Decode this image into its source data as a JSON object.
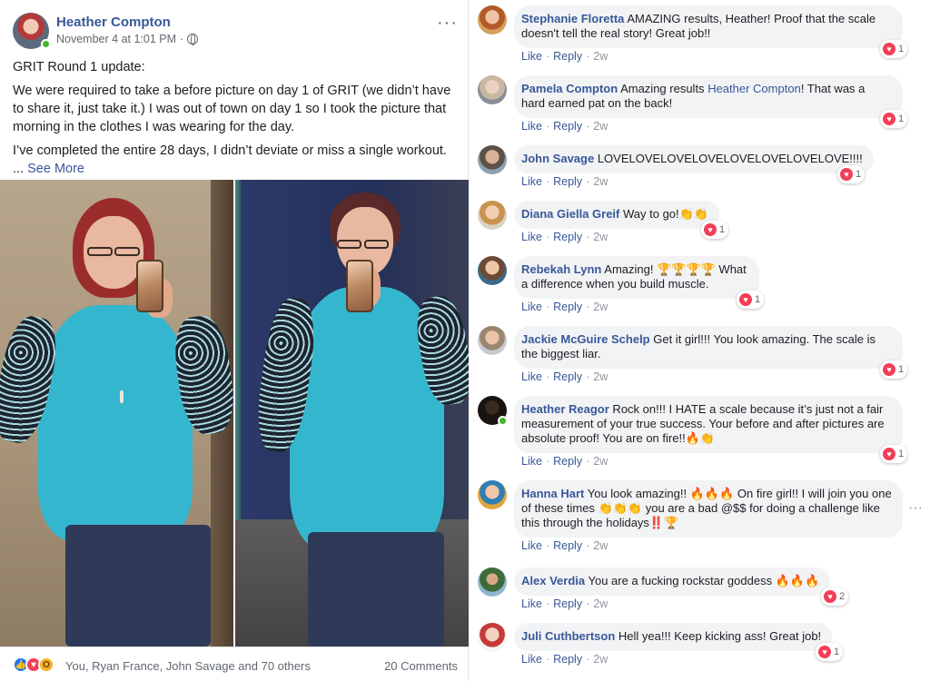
{
  "post": {
    "author": "Heather Compton",
    "timestamp": "November 4 at 1:01 PM",
    "separator": "·",
    "more_glyph": "···",
    "paragraphs": [
      "GRIT Round 1 update:",
      "We were required to take a before picture on day 1 of GRIT (we didn’t have to share it, just take it.) I was out of town on day 1 so I took the picture that morning in the clothes I was wearing for the day.",
      "I’ve completed the entire 28 days, I didn’t deviate or miss a single workout."
    ],
    "ellipsis": "...",
    "see_more": "See More",
    "reactions": {
      "icons": [
        "like-icon",
        "love-icon",
        "wow-icon"
      ],
      "summary": "You, Ryan France, John Savage and 70 others",
      "comments_count": "20 Comments"
    }
  },
  "colors": {
    "link": "#385898",
    "like": "#1877f2",
    "love": "#f33e58",
    "wow": "#f7b125",
    "bubble": "#f2f3f5",
    "online": "#42b72a"
  },
  "comments": [
    {
      "name": "Stephanie Floretta",
      "text": " AMAZING results, Heather! Proof that the scale doesn't tell the real story! Great job!!",
      "reacts": "1",
      "like": "Like",
      "reply": "Reply",
      "time": "2w"
    },
    {
      "name": "Pamela Compton",
      "text_before": " Amazing results ",
      "mention": "Heather Compton",
      "text_after": "! That was a hard earned pat on the back!",
      "reacts": "1",
      "like": "Like",
      "reply": "Reply",
      "time": "2w"
    },
    {
      "name": "John Savage",
      "text": " LOVELOVELOVELOVELOVELOVELOVELOVE!!!!",
      "reacts": "1",
      "like": "Like",
      "reply": "Reply",
      "time": "2w"
    },
    {
      "name": "Diana Giella Greif",
      "text": " Way to go!👏👏",
      "reacts": "1",
      "like": "Like",
      "reply": "Reply",
      "time": "2w"
    },
    {
      "name": "Rebekah Lynn",
      "text": " Amazing! 🏆🏆🏆🏆 What a difference when you build muscle.",
      "reacts": "1",
      "like": "Like",
      "reply": "Reply",
      "time": "2w"
    },
    {
      "name": "Jackie McGuire Schelp",
      "text": " Get it girl!!! You look amazing. The scale is the biggest liar.",
      "reacts": "1",
      "like": "Like",
      "reply": "Reply",
      "time": "2w"
    },
    {
      "name": "Heather Reagor",
      "text": " Rock on!!! I HATE a scale because it’s just not a fair measurement of your true success. Your before and after pictures are absolute proof! You are on fire!!🔥👏",
      "reacts": "1",
      "like": "Like",
      "reply": "Reply",
      "time": "2w"
    },
    {
      "name": "Hanna Hart",
      "text": " You look amazing!! 🔥🔥🔥 On fire girl!! I will join you one of these times 👏👏👏 you are a bad @$$ for doing a challenge like this through the holidays‼️🏆",
      "reacts": "",
      "like": "Like",
      "reply": "Reply",
      "time": "2w",
      "more": "···"
    },
    {
      "name": "Alex Verdia",
      "text": " You are a fucking rockstar goddess 🔥🔥🔥",
      "reacts": "2",
      "like": "Like",
      "reply": "Reply",
      "time": "2w"
    },
    {
      "name": "Juli Cuthbertson",
      "text": " Hell yea!!! Keep kicking ass! Great job!",
      "reacts": "1",
      "like": "Like",
      "reply": "Reply",
      "time": "2w"
    }
  ]
}
